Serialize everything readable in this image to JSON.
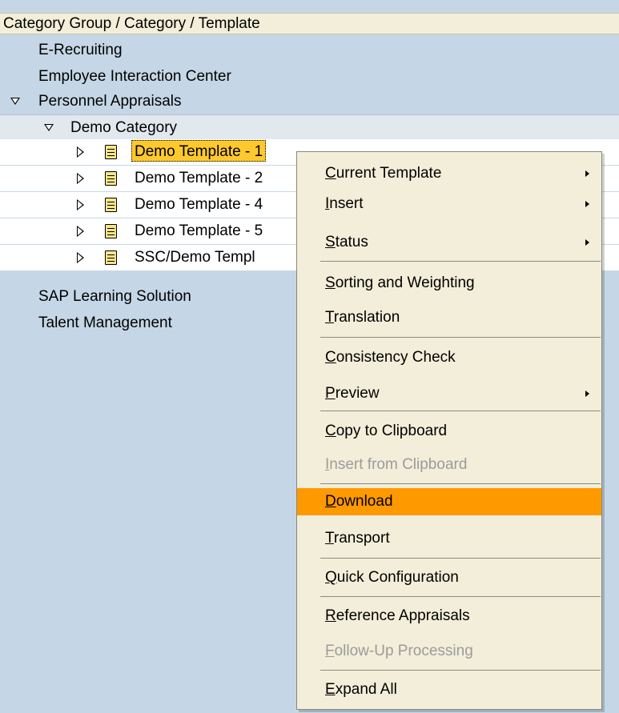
{
  "header": {
    "title": "Category Group / Category / Template"
  },
  "tree": {
    "items": [
      {
        "label": "E-Recruiting"
      },
      {
        "label": "Employee Interaction Center"
      },
      {
        "label": "Personnel Appraisals"
      },
      {
        "label": "Demo Category"
      },
      {
        "label": "Demo Template - 1"
      },
      {
        "label": "Demo Template - 2"
      },
      {
        "label": "Demo Template - 4"
      },
      {
        "label": "Demo Template - 5"
      },
      {
        "label": "SSC/Demo Templ"
      },
      {
        "label": "SAP Learning Solution"
      },
      {
        "label": "Talent Management"
      }
    ]
  },
  "menu": {
    "items": [
      {
        "mn": "C",
        "rest": "urrent Template",
        "submenu": true
      },
      {
        "mn": "I",
        "rest": "nsert",
        "submenu": true
      },
      {
        "mn": "S",
        "rest": "tatus",
        "submenu": true
      },
      {
        "mn": "S",
        "rest": "orting and Weighting"
      },
      {
        "mn": "T",
        "rest": "ranslation"
      },
      {
        "mn": "C",
        "rest": "onsistency Check"
      },
      {
        "mn": "P",
        "rest": "review",
        "submenu": true
      },
      {
        "mn": "C",
        "rest": "opy to Clipboard"
      },
      {
        "mn": "I",
        "rest": "nsert from Clipboard",
        "disabled": true
      },
      {
        "mn": "D",
        "rest": "ownload",
        "active": true
      },
      {
        "mn": "T",
        "rest": "ransport"
      },
      {
        "mn": "Q",
        "rest": "uick Configuration"
      },
      {
        "mn": "R",
        "rest": "eference Appraisals"
      },
      {
        "mn": "F",
        "rest": "ollow-Up Processing",
        "disabled": true
      },
      {
        "mn": "E",
        "rest": "xpand All"
      }
    ]
  },
  "colors": {
    "highlight": "#ff9900",
    "selection": "#ffc92e",
    "tree_bg": "#c5d7e6",
    "menu_bg": "#f2eed9"
  }
}
